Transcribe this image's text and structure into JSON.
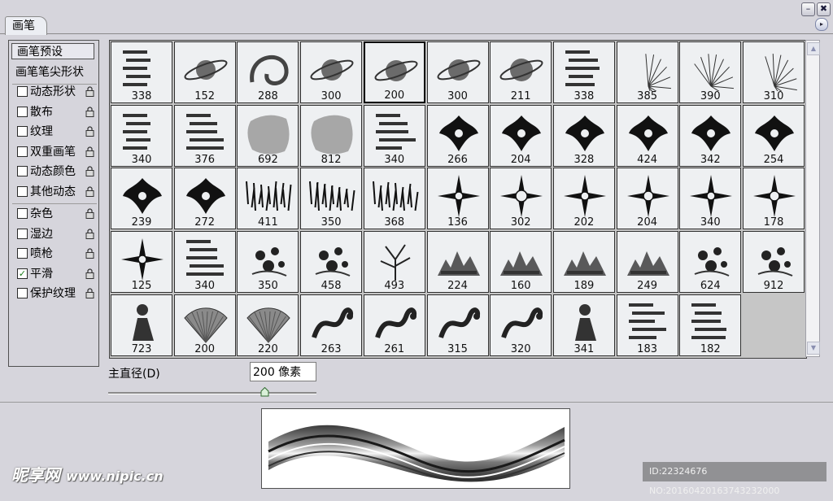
{
  "panel": {
    "tab_label": "画笔",
    "minimize_label": "–",
    "close_label": "✖",
    "menu_arrow": "▸"
  },
  "sidebar": {
    "preset_label": "画笔预设",
    "tip_shape_label": "画笔笔尖形状",
    "options_group1": [
      {
        "label": "动态形状",
        "checked": false
      },
      {
        "label": "散布",
        "checked": false
      },
      {
        "label": "纹理",
        "checked": false
      },
      {
        "label": "双重画笔",
        "checked": false
      },
      {
        "label": "动态颜色",
        "checked": false
      },
      {
        "label": "其他动态",
        "checked": false
      }
    ],
    "options_group2": [
      {
        "label": "杂色",
        "checked": false
      },
      {
        "label": "湿边",
        "checked": false
      },
      {
        "label": "喷枪",
        "checked": false
      },
      {
        "label": "平滑",
        "checked": true
      },
      {
        "label": "保护纹理",
        "checked": false
      }
    ],
    "check_mark": "✓"
  },
  "brushes": {
    "selected_index": 4,
    "sizes": [
      338,
      152,
      288,
      300,
      200,
      300,
      211,
      338,
      385,
      390,
      310,
      340,
      376,
      692,
      812,
      340,
      266,
      204,
      328,
      424,
      342,
      254,
      239,
      272,
      411,
      350,
      368,
      136,
      302,
      202,
      204,
      340,
      178,
      125,
      340,
      350,
      458,
      493,
      224,
      160,
      189,
      249,
      624,
      912,
      723,
      200,
      220,
      263,
      261,
      315,
      320,
      341,
      183,
      182
    ],
    "thumb_kinds": [
      "text",
      "planet",
      "swirl",
      "planet",
      "planet",
      "planet",
      "planet",
      "text",
      "spikes",
      "spikes",
      "spikes",
      "text",
      "text",
      "blob",
      "blob",
      "text",
      "ornament",
      "ornament",
      "ornament",
      "ornament",
      "ornament",
      "ornament",
      "ornament",
      "ornament",
      "grass",
      "grass",
      "grass",
      "star",
      "star",
      "star",
      "star",
      "star",
      "star",
      "star",
      "text",
      "floral",
      "floral",
      "tree",
      "landscape",
      "landscape",
      "landscape",
      "landscape",
      "floral",
      "floral",
      "figure",
      "fan",
      "fan",
      "dragon",
      "dragon",
      "dragon",
      "dragon",
      "figure",
      "text",
      "text"
    ]
  },
  "scrollbar": {
    "up": "▲",
    "down": "▼"
  },
  "diameter": {
    "label": "主直径(D)",
    "value": "200 像素",
    "level": 0.75
  },
  "watermark": {
    "brand": "昵享网",
    "site": "www.nipic.cn",
    "id_text": "ID:22324676 NO:20160420163743232000"
  }
}
